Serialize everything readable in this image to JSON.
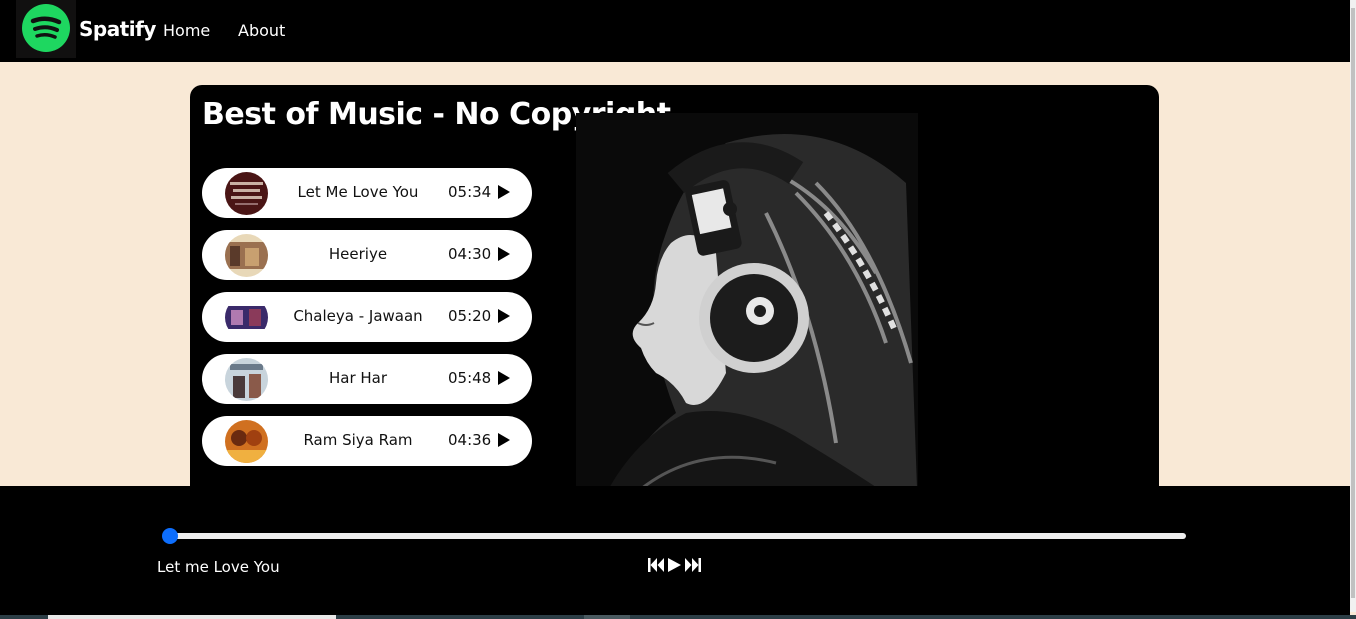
{
  "nav": {
    "brand": "Spatify",
    "links": [
      {
        "label": "Home"
      },
      {
        "label": "About"
      }
    ]
  },
  "main": {
    "title": "Best of Music - No Copyright",
    "songs": [
      {
        "name": "Let Me Love You",
        "duration": "05:34",
        "cover_color": "#5a1818"
      },
      {
        "name": "Heeriye",
        "duration": "04:30",
        "cover_color": "#8a6a4a"
      },
      {
        "name": "Chaleya - Jawaan",
        "duration": "05:20",
        "cover_color": "#3a2a5a"
      },
      {
        "name": "Har Har",
        "duration": "05:48",
        "cover_color": "#7a8a9a"
      },
      {
        "name": "Ram Siya Ram",
        "duration": "04:36",
        "cover_color": "#c06a20"
      }
    ]
  },
  "player": {
    "current_song": "Let me Love You",
    "progress": 0
  },
  "colors": {
    "page_bg": "#f9e9d6",
    "accent_green": "#1ed760",
    "slider_blue": "#0d6efd"
  }
}
